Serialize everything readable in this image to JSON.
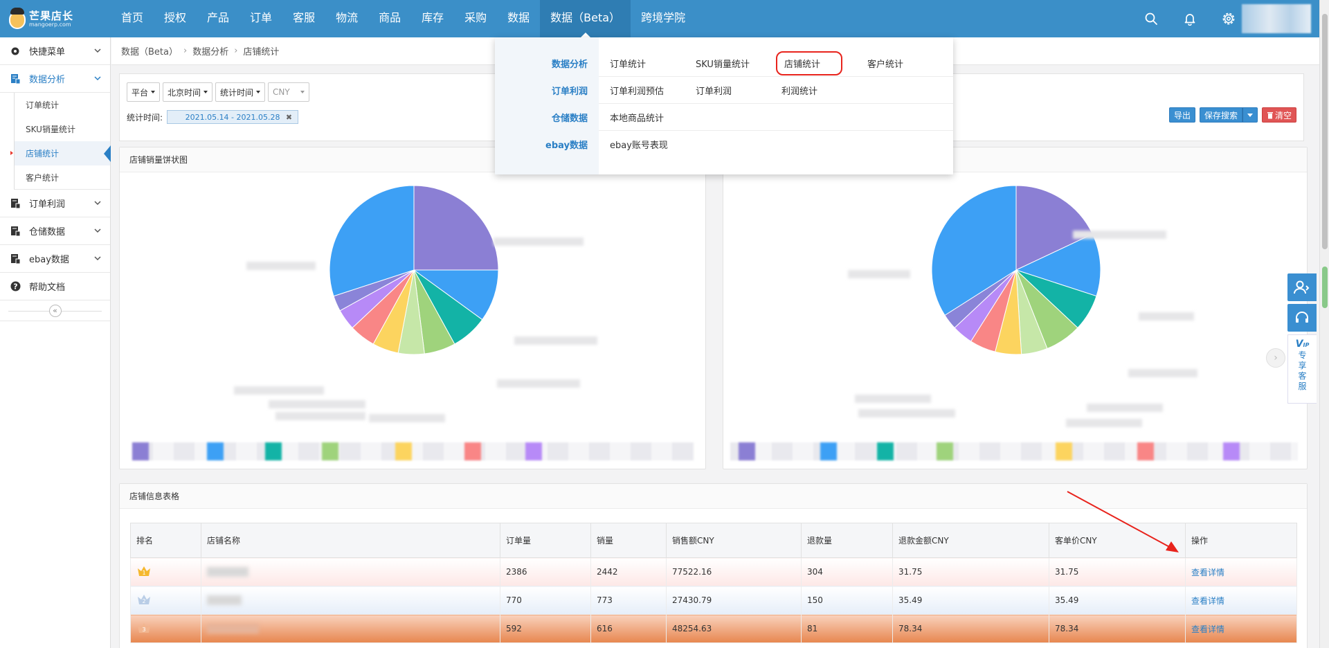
{
  "brand": {
    "name": "芒果店长",
    "domain": "mangoerp.com"
  },
  "nav": {
    "items": [
      "首页",
      "授权",
      "产品",
      "订单",
      "客服",
      "物流",
      "商品",
      "库存",
      "采购",
      "数据",
      "数据（Beta）",
      "跨境学院"
    ],
    "active": "数据（Beta）"
  },
  "top_icons": [
    "search-icon",
    "bell-icon",
    "gear-icon"
  ],
  "sidebar": {
    "groups": [
      {
        "label": "快捷菜单",
        "icon": "gear-icon"
      },
      {
        "label": "数据分析",
        "icon": "chart-doc-icon",
        "open": true,
        "children": [
          "订单统计",
          "SKU销量统计",
          "店铺统计",
          "客户统计"
        ],
        "current": "店铺统计"
      },
      {
        "label": "订单利润",
        "icon": "doc-icon"
      },
      {
        "label": "仓储数据",
        "icon": "doc-icon"
      },
      {
        "label": "ebay数据",
        "icon": "doc-icon"
      },
      {
        "label": "帮助文档",
        "icon": "help-icon"
      }
    ]
  },
  "breadcrumb": [
    "数据（Beta）",
    "数据分析",
    "店铺统计"
  ],
  "filters": {
    "platform": "平台",
    "timezone": "北京时间",
    "time_type": "统计时间",
    "currency": "CNY",
    "date_label": "统计时间:",
    "date_range": "2021.05.14 - 2021.05.28",
    "export": "导出",
    "save_search": "保存搜索",
    "clear": "清空"
  },
  "chart_left_title": "店铺销量饼状图",
  "chart_data": [
    {
      "type": "pie",
      "title": "店铺销量饼状图",
      "values": [
        0.25,
        0.1,
        0.07,
        0.06,
        0.05,
        0.05,
        0.05,
        0.04,
        0.03,
        0.3
      ],
      "colors": [
        "#8b7fd4",
        "#3da0f5",
        "#13b3a6",
        "#9fd37c",
        "#c6e7a8",
        "#fcd45f",
        "#f98686",
        "#b78af7",
        "#8a84d8",
        "#3da0f5"
      ]
    },
    {
      "type": "pie",
      "values": [
        0.18,
        0.12,
        0.07,
        0.07,
        0.05,
        0.05,
        0.05,
        0.04,
        0.03,
        0.34
      ],
      "colors": [
        "#8b7fd4",
        "#3da0f5",
        "#13b3a6",
        "#9fd37c",
        "#c6e7a8",
        "#fcd45f",
        "#f98686",
        "#b78af7",
        "#8a84d8",
        "#3da0f5"
      ]
    }
  ],
  "table": {
    "title": "店铺信息表格",
    "headers": [
      "排名",
      "店铺名称",
      "订单量",
      "销量",
      "销售额CNY",
      "退款量",
      "退款金额CNY",
      "客单价CNY",
      "操作"
    ],
    "rows": [
      {
        "rank": "1",
        "orders": "2386",
        "sales": "2442",
        "amount": "77522.16",
        "refunds": "304",
        "refund_amount": "31.75",
        "avg": "31.75",
        "action": "查看详情"
      },
      {
        "rank": "2",
        "orders": "770",
        "sales": "773",
        "amount": "27430.79",
        "refunds": "150",
        "refund_amount": "35.49",
        "avg": "35.49",
        "action": "查看详情"
      },
      {
        "rank": "3",
        "orders": "592",
        "sales": "616",
        "amount": "48254.63",
        "refunds": "81",
        "refund_amount": "78.34",
        "avg": "78.34",
        "action": "查看详情"
      }
    ]
  },
  "dropdown": {
    "rows": [
      {
        "category": "数据分析",
        "items": [
          "订单统计",
          "SKU销量统计",
          "店铺统计",
          "客户统计"
        ]
      },
      {
        "category": "订单利润",
        "items": [
          "订单利润预估",
          "订单利润",
          "利润统计"
        ]
      },
      {
        "category": "仓储数据",
        "items": [
          "本地商品统计"
        ]
      },
      {
        "category": "ebay数据",
        "items": [
          "ebay账号表现"
        ]
      }
    ],
    "highlighted": "店铺统计"
  },
  "float_bar": {
    "vip_text": [
      "专",
      "享",
      "客",
      "服"
    ]
  }
}
